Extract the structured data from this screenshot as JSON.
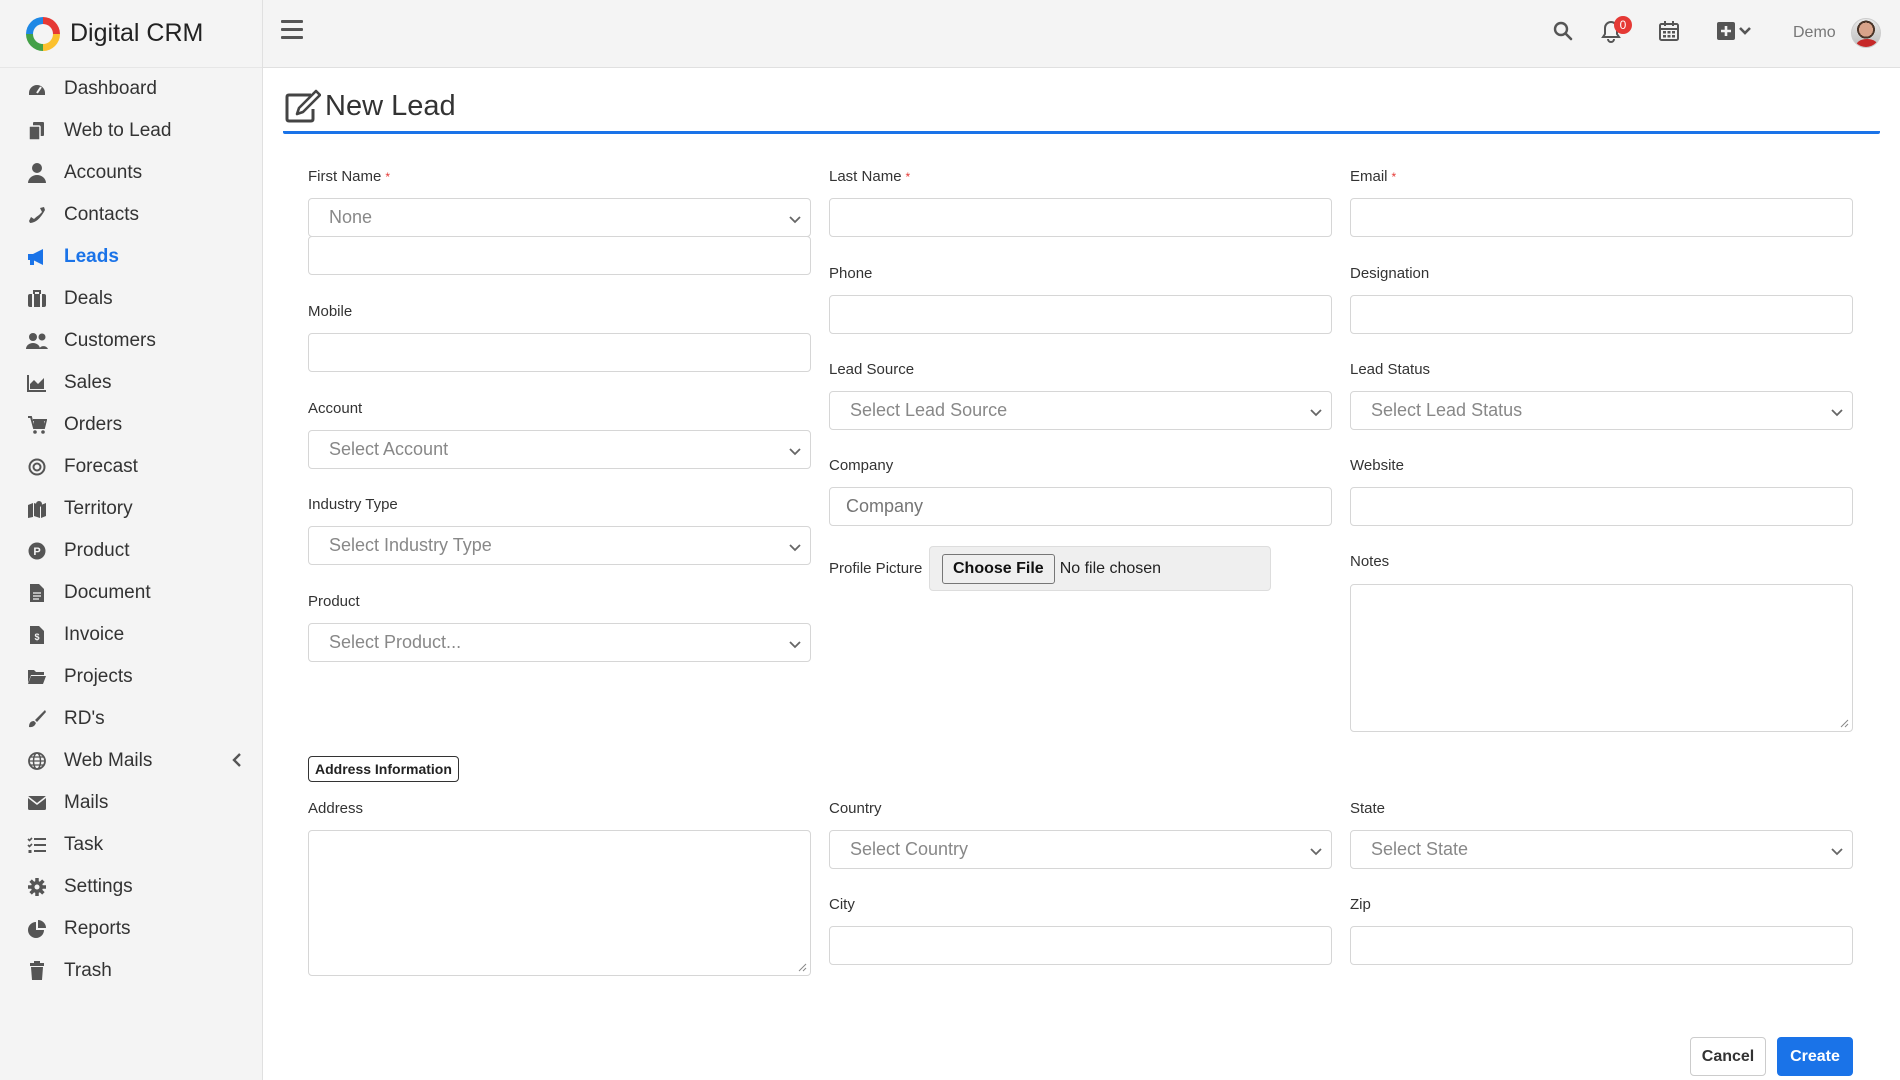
{
  "app": {
    "title": "Digital CRM",
    "user": "Demo",
    "notification_count": "0"
  },
  "sidebar": {
    "items": [
      {
        "label": "Dashboard",
        "icon": "dashboard-icon"
      },
      {
        "label": "Web to Lead",
        "icon": "copy-icon"
      },
      {
        "label": "Accounts",
        "icon": "user-icon"
      },
      {
        "label": "Contacts",
        "icon": "phone-icon"
      },
      {
        "label": "Leads",
        "icon": "megaphone-icon",
        "active": true
      },
      {
        "label": "Deals",
        "icon": "briefcase-icon"
      },
      {
        "label": "Customers",
        "icon": "users-icon"
      },
      {
        "label": "Sales",
        "icon": "area-chart-icon"
      },
      {
        "label": "Orders",
        "icon": "cart-icon"
      },
      {
        "label": "Forecast",
        "icon": "target-icon"
      },
      {
        "label": "Territory",
        "icon": "map-icon"
      },
      {
        "label": "Product",
        "icon": "product-icon"
      },
      {
        "label": "Document",
        "icon": "file-icon"
      },
      {
        "label": "Invoice",
        "icon": "invoice-icon"
      },
      {
        "label": "Projects",
        "icon": "folder-icon"
      },
      {
        "label": "RD's",
        "icon": "brush-icon"
      },
      {
        "label": "Web Mails",
        "icon": "globe-icon"
      },
      {
        "label": "Mails",
        "icon": "envelope-icon"
      },
      {
        "label": "Task",
        "icon": "tasks-icon"
      },
      {
        "label": "Settings",
        "icon": "gear-icon"
      },
      {
        "label": "Reports",
        "icon": "pie-chart-icon"
      },
      {
        "label": "Trash",
        "icon": "trash-icon"
      }
    ]
  },
  "page": {
    "title": "New Lead"
  },
  "form": {
    "first_name": {
      "label": "First Name",
      "salutation": "None"
    },
    "last_name": {
      "label": "Last Name"
    },
    "email": {
      "label": "Email"
    },
    "mobile": {
      "label": "Mobile"
    },
    "phone": {
      "label": "Phone"
    },
    "designation": {
      "label": "Designation"
    },
    "account": {
      "label": "Account",
      "placeholder": "Select Account"
    },
    "lead_source": {
      "label": "Lead Source",
      "placeholder": "Select Lead Source"
    },
    "lead_status": {
      "label": "Lead Status",
      "placeholder": "Select Lead Status"
    },
    "industry_type": {
      "label": "Industry Type",
      "placeholder": "Select Industry Type"
    },
    "company": {
      "label": "Company",
      "placeholder": "Company"
    },
    "website": {
      "label": "Website"
    },
    "product": {
      "label": "Product",
      "placeholder": "Select Product..."
    },
    "profile_picture": {
      "label": "Profile Picture",
      "button": "Choose File",
      "status": "No file chosen"
    },
    "notes": {
      "label": "Notes"
    },
    "address_section": "Address Information",
    "address": {
      "label": "Address"
    },
    "country": {
      "label": "Country",
      "placeholder": "Select Country"
    },
    "state": {
      "label": "State",
      "placeholder": "Select State"
    },
    "city": {
      "label": "City"
    },
    "zip": {
      "label": "Zip"
    },
    "required_marker": "*"
  },
  "actions": {
    "cancel": "Cancel",
    "create": "Create"
  },
  "colors": {
    "accent": "#1a73e8",
    "required": "#e53935",
    "sidebar_bg": "#f4f4f4"
  }
}
